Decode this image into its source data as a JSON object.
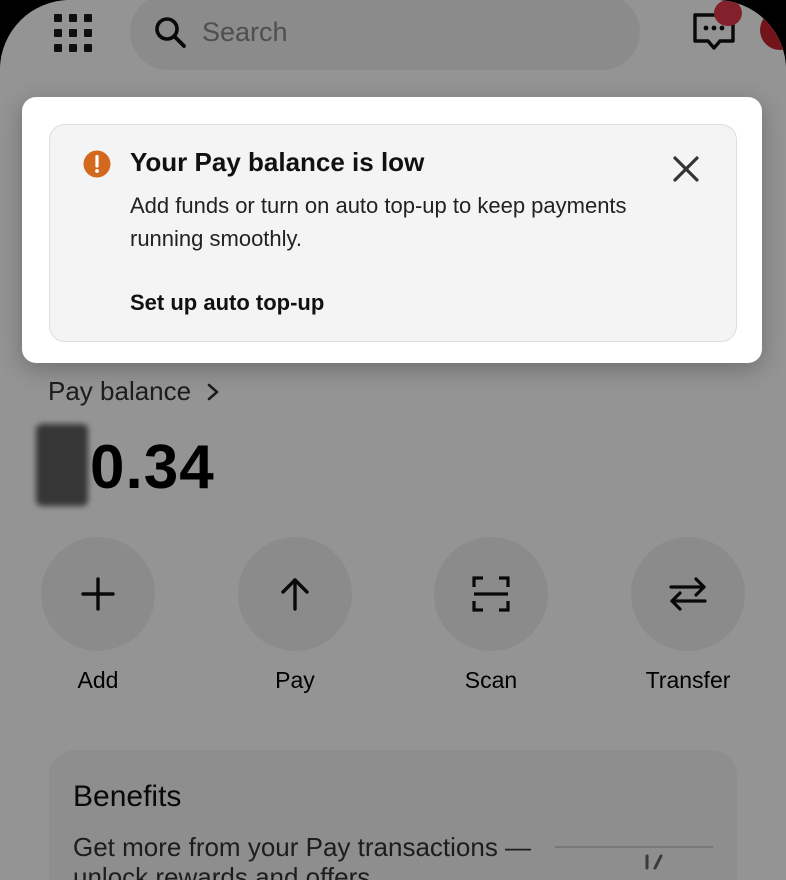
{
  "search": {
    "placeholder": "Search"
  },
  "balance": {
    "label": "Pay balance",
    "amount": "0.34"
  },
  "actions": [
    {
      "label": "Add",
      "icon": "plus-icon"
    },
    {
      "label": "Pay",
      "icon": "arrow-up-icon"
    },
    {
      "label": "Scan",
      "icon": "scan-icon"
    },
    {
      "label": "Transfer",
      "icon": "transfer-icon"
    }
  ],
  "benefits": {
    "title": "Benefits",
    "description": "Get more from your Pay transactions — unlock rewards and offers"
  },
  "alert": {
    "title": "Your Pay balance is low",
    "body": "Add funds or turn on auto top-up to keep payments running smoothly.",
    "link": "Set up auto top-up"
  },
  "colors": {
    "warning": "#d2691e",
    "notification": "#e0384a",
    "scrim": "rgba(0,0,0,0.42)"
  }
}
